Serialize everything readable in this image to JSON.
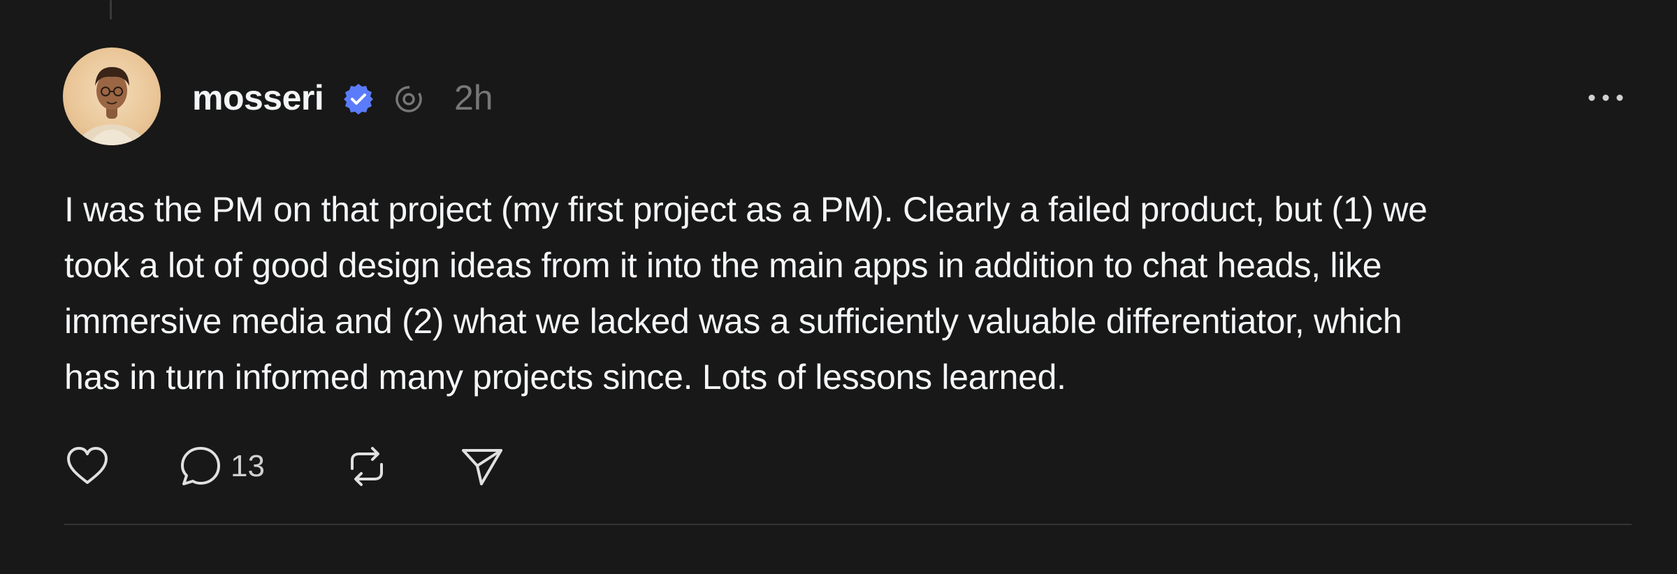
{
  "post": {
    "username": "mosseri",
    "timestamp": "2h",
    "body": "I was the PM on that project (my first project as a PM). Clearly a failed product, but (1) we\ntook a lot of good design ideas from it into the main apps in addition to chat heads, like\nimmersive media and (2) what we lacked was a sufficiently valuable differentiator, which\nhas in turn informed many projects since. Lots of lessons learned.",
    "reply_count": "13"
  },
  "icons": {
    "verified": "verified-badge-icon",
    "threads": "threads-logo-icon",
    "more": "more-options-icon",
    "like": "heart-icon",
    "reply": "comment-icon",
    "repost": "repost-icon",
    "share": "send-icon"
  },
  "colors": {
    "background": "#181818",
    "text": "#f3f5f7",
    "muted": "#777777",
    "verified": "#5b7cfa"
  }
}
